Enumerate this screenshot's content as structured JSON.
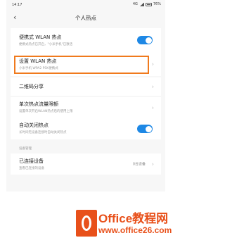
{
  "status_bar": {
    "time": "14:17",
    "network": "4G",
    "battery": "76%"
  },
  "header": {
    "back_icon": "chevron-left-icon",
    "title": "个人热点"
  },
  "rows": {
    "portable_hotspot": {
      "label": "便携式 WLAN 热点",
      "sub": "便携式热点已开启，\"小米手机\"已激活",
      "toggle_on": true
    },
    "setup_hotspot": {
      "label": "设置 WLAN 热点",
      "sub": "小米手机 WPA2 PSK便携式"
    },
    "qr_share": {
      "label": "二维码分享"
    },
    "data_limit": {
      "label": "单次热点流量限额",
      "sub": "设置单次开启WLAN热点后的使用上限"
    },
    "auto_off": {
      "label": "自动关闭热点",
      "sub": "长时间无设备连接时自动关闭热点",
      "toggle_on": true
    }
  },
  "section": {
    "device_management": "设备管理"
  },
  "connected_devices": {
    "label": "已连接设备",
    "sub": "查看已连接的设备",
    "count": "0台设备"
  },
  "watermark": {
    "brand": "Office教程网",
    "url": "www.office26.com"
  },
  "colors": {
    "accent": "#1e88e5",
    "highlight_border": "#f07a1d",
    "logo": "#e8501a"
  }
}
